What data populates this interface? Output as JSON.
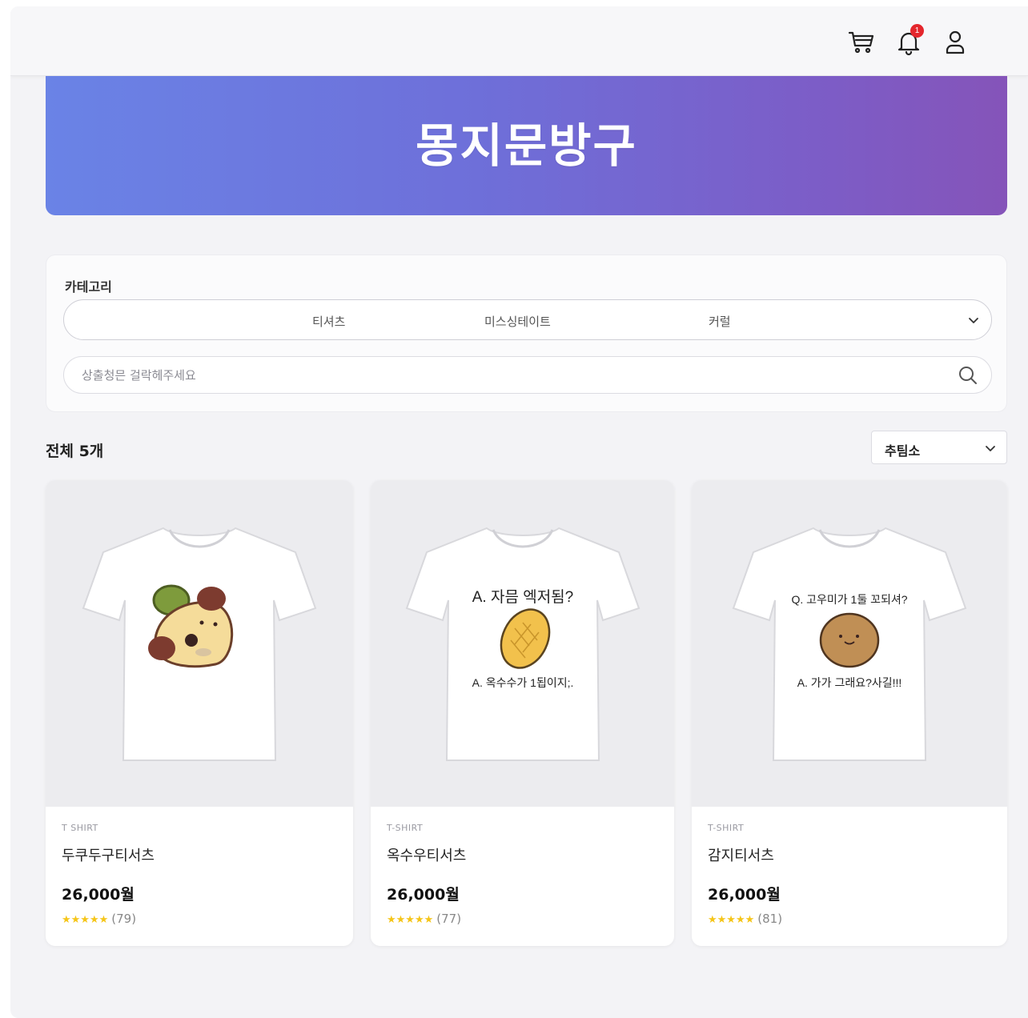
{
  "header": {
    "cart_icon": "cart-icon",
    "bell_icon": "bell-icon",
    "notification_count": "1",
    "user_icon": "user-icon"
  },
  "hero": {
    "title": "몽지문방구"
  },
  "filter": {
    "title": "카테고리",
    "categories": [
      "티셔츠",
      "미스싱테이트",
      "커럴"
    ],
    "search_placeholder": "상출청믄 걸락헤주세요"
  },
  "list": {
    "count_label": "전체 5개",
    "sort_label": "추팀소"
  },
  "products": [
    {
      "category": "T SHIRT",
      "name": "두쿠두구티서츠",
      "price": "26,000월",
      "stars": "★★★★★",
      "reviews": "(79)",
      "art_top": "",
      "art_bottom": ""
    },
    {
      "category": "T-SHIRT",
      "name": "옥수우티서츠",
      "price": "26,000월",
      "stars": "★★★★★",
      "reviews": "(77)",
      "art_top": "A. 자믐 엑저됨?",
      "art_bottom": "A. 옥수수가 1됩이지;."
    },
    {
      "category": "T-SHIRT",
      "name": "감지티서츠",
      "price": "26,000월",
      "stars": "★★★★★",
      "reviews": "(81)",
      "art_top": "Q. 고우미가 1둘 꼬되셔?",
      "art_bottom": "A. 가가 그래요?사길!!!"
    }
  ],
  "colors": {
    "hero_start": "#6a83e6",
    "hero_end": "#8554b9",
    "star": "#f5c518",
    "badge": "#e4262c"
  }
}
